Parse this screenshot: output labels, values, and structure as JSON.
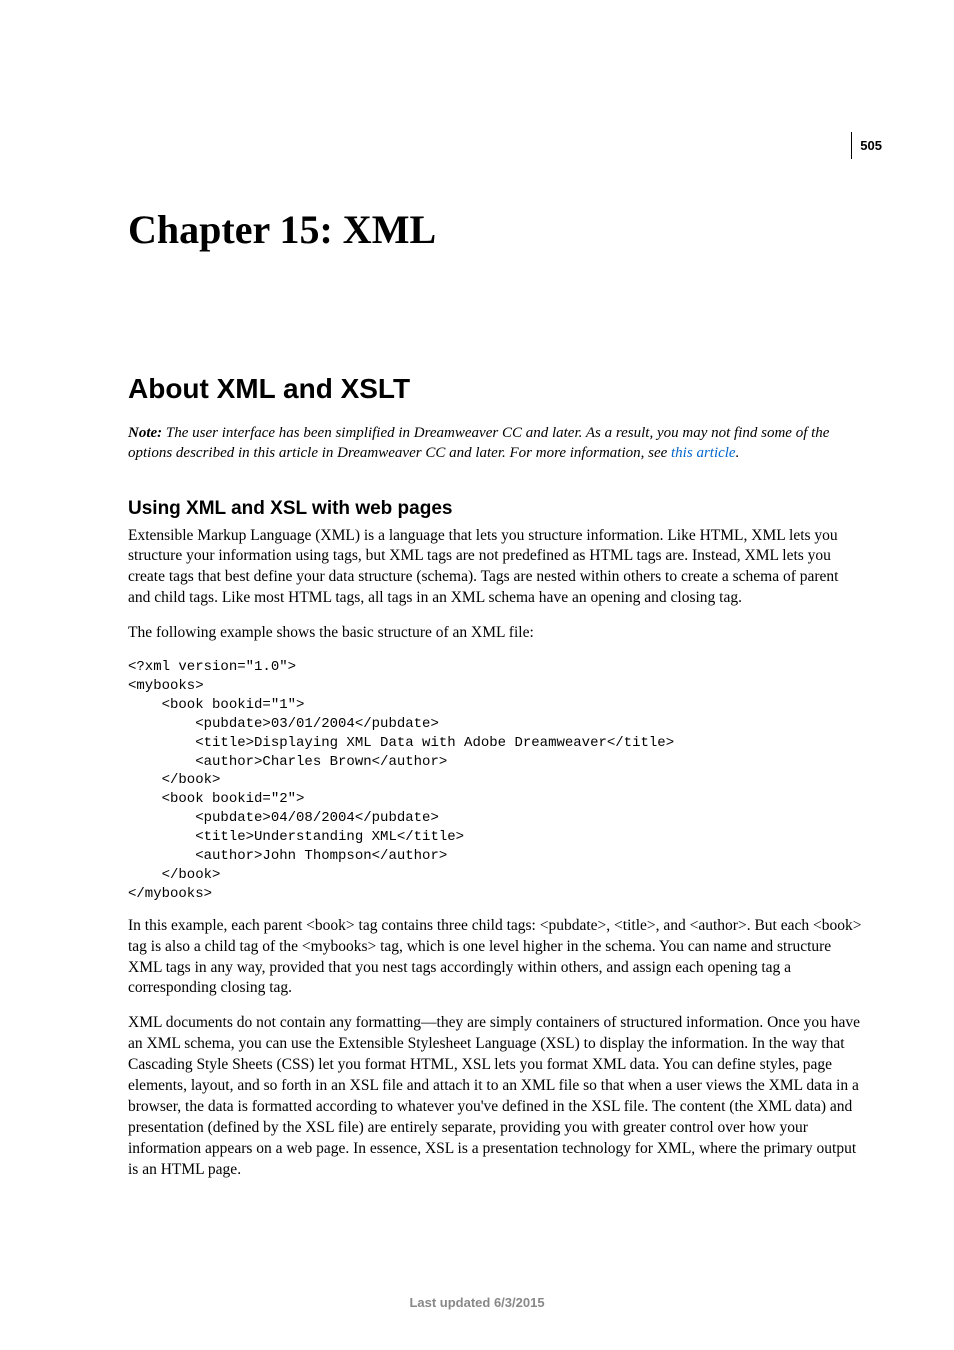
{
  "page_number": "505",
  "chapter_title": "Chapter 15: XML",
  "section_title": "About XML and XSLT",
  "note": {
    "label": "Note:",
    "text_before_link": " The user interface has been simplified in Dreamweaver CC and later. As a result, you may not find some of the options described in this article in Dreamweaver CC and later. For more information, see ",
    "link_text": "this article",
    "text_after_link": "."
  },
  "subsection_title": "Using XML and XSL with web pages",
  "para1": "Extensible Markup Language (XML) is a language that lets you structure information. Like HTML, XML lets you structure your information using tags, but XML tags are not predefined as HTML tags are. Instead, XML lets you create tags that best define your data structure (schema). Tags are nested within others to create a schema of parent and child tags. Like most HTML tags, all tags in an XML schema have an opening and closing tag.",
  "para2": "The following example shows the basic structure of an XML file:",
  "code": "<?xml version=\"1.0\">\n<mybooks>\n    <book bookid=\"1\">\n        <pubdate>03/01/2004</pubdate>\n        <title>Displaying XML Data with Adobe Dreamweaver</title>\n        <author>Charles Brown</author>\n    </book>\n    <book bookid=\"2\">\n        <pubdate>04/08/2004</pubdate>\n        <title>Understanding XML</title>\n        <author>John Thompson</author>\n    </book>\n</mybooks>",
  "para3": "In this example, each parent <book> tag contains three child tags: <pubdate>, <title>, and <author>. But each <book> tag is also a child tag of the <mybooks> tag, which is one level higher in the schema. You can name and structure XML tags in any way, provided that you nest tags accordingly within others, and assign each opening tag a corresponding closing tag.",
  "para4": "XML documents do not contain any formatting—they are simply containers of structured information. Once you have an XML schema, you can use the Extensible Stylesheet Language (XSL) to display the information. In the way that Cascading Style Sheets (CSS) let you format HTML, XSL lets you format XML data. You can define styles, page elements, layout, and so forth in an XSL file and attach it to an XML file so that when a user views the XML data in a browser, the data is formatted according to whatever you've defined in the XSL file. The content (the XML data) and presentation (defined by the XSL file) are entirely separate, providing you with greater control over how your information appears on a web page. In essence, XSL is a presentation technology for XML, where the primary output is an HTML page.",
  "footer": "Last updated 6/3/2015"
}
